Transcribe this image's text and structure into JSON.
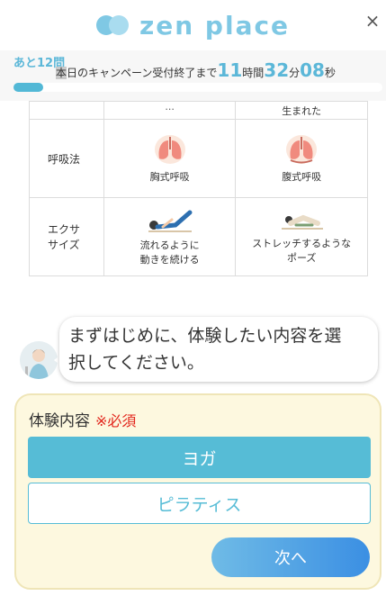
{
  "header": {
    "brand": "zen place",
    "close_glyph": "×"
  },
  "campaign": {
    "remaining_label": "あと12問",
    "prefix_highlight": "本",
    "prefix": "日のキャンペーン受付終了まで",
    "hours": "11",
    "hours_unit": "時間",
    "minutes": "32",
    "minutes_unit": "分",
    "seconds": "08",
    "seconds_unit": "秒",
    "progress_fraction": 0.08
  },
  "comparison": {
    "rows": [
      {
        "label": "",
        "cells": [
          {
            "text1": "...",
            "text2": ""
          },
          {
            "text1": "生まれた",
            "text2": ""
          }
        ]
      },
      {
        "label": "呼吸法",
        "cells": [
          {
            "text1": "胸式呼吸",
            "text2": "",
            "icon": "lungs-icon"
          },
          {
            "text1": "腹式呼吸",
            "text2": "",
            "icon": "lungs-icon"
          }
        ]
      },
      {
        "label1": "エクサ",
        "label2": "サイズ",
        "cells": [
          {
            "text1": "流れるように",
            "text2": "動きを続ける",
            "icon": "pilates-pose-icon"
          },
          {
            "text1": "ストレッチするような",
            "text2": "ポーズ",
            "icon": "yoga-pose-icon"
          }
        ]
      }
    ]
  },
  "chat": {
    "message_line1": "まずはじめに、体験したい内容を選",
    "message_line2": "択してください。"
  },
  "form": {
    "title": "体験内容",
    "required_label": "※必須",
    "options": [
      "ヨガ",
      "ピラティス"
    ],
    "selected": "ヨガ",
    "next_label": "次へ"
  },
  "colors": {
    "accent": "#56bcd6",
    "required": "#e2261c",
    "card_bg": "#fdf8df"
  }
}
